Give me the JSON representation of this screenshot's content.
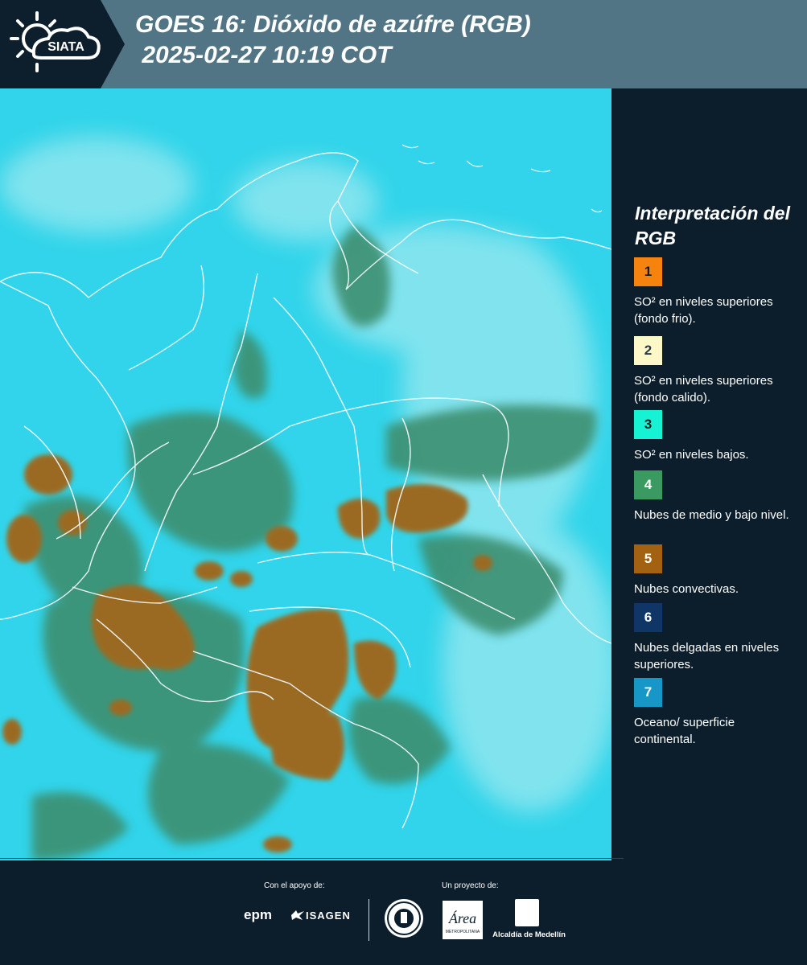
{
  "header": {
    "title_line1": "GOES 16: Dióxido de azúfre (RGB)",
    "title_line2": " 2025-02-27 10:19 COT",
    "logo_text": "SIATA"
  },
  "legend": {
    "title": "Interpretación del RGB",
    "items": [
      {
        "number": "1",
        "color": "#f7830f",
        "text": "SO² en niveles superiores (fondo frio)."
      },
      {
        "number": "2",
        "color": "#fcf8c8",
        "text": "SO² en niveles superiores (fondo calido)."
      },
      {
        "number": "3",
        "color": "#15f2d4",
        "text": "SO² en niveles bajos."
      },
      {
        "number": "4",
        "color": "#3a9a62",
        "text": "Nubes de medio y bajo nivel."
      },
      {
        "number": "5",
        "color": "#a26212",
        "text": "Nubes convectivas."
      },
      {
        "number": "6",
        "color": "#0f3667",
        "text": "Nubes delgadas en niveles superiores."
      },
      {
        "number": "7",
        "color": "#1796c8",
        "text": "Oceano/ superficie continental."
      }
    ]
  },
  "footer": {
    "support_label": "Con el apoyo de:",
    "project_label": "Un proyecto de:",
    "epm": "epm",
    "isagen": "ISAGEN",
    "area_name": "Área",
    "area_sub": "METROPOLITANA",
    "alcaldia": "Alcaldía de Medellín"
  },
  "colors": {
    "header_bg": "#527585",
    "page_bg": "#0c1e2c",
    "sea": "#2fd6ea",
    "convective": "#9b6a22",
    "midcloud": "#3c8f72"
  }
}
